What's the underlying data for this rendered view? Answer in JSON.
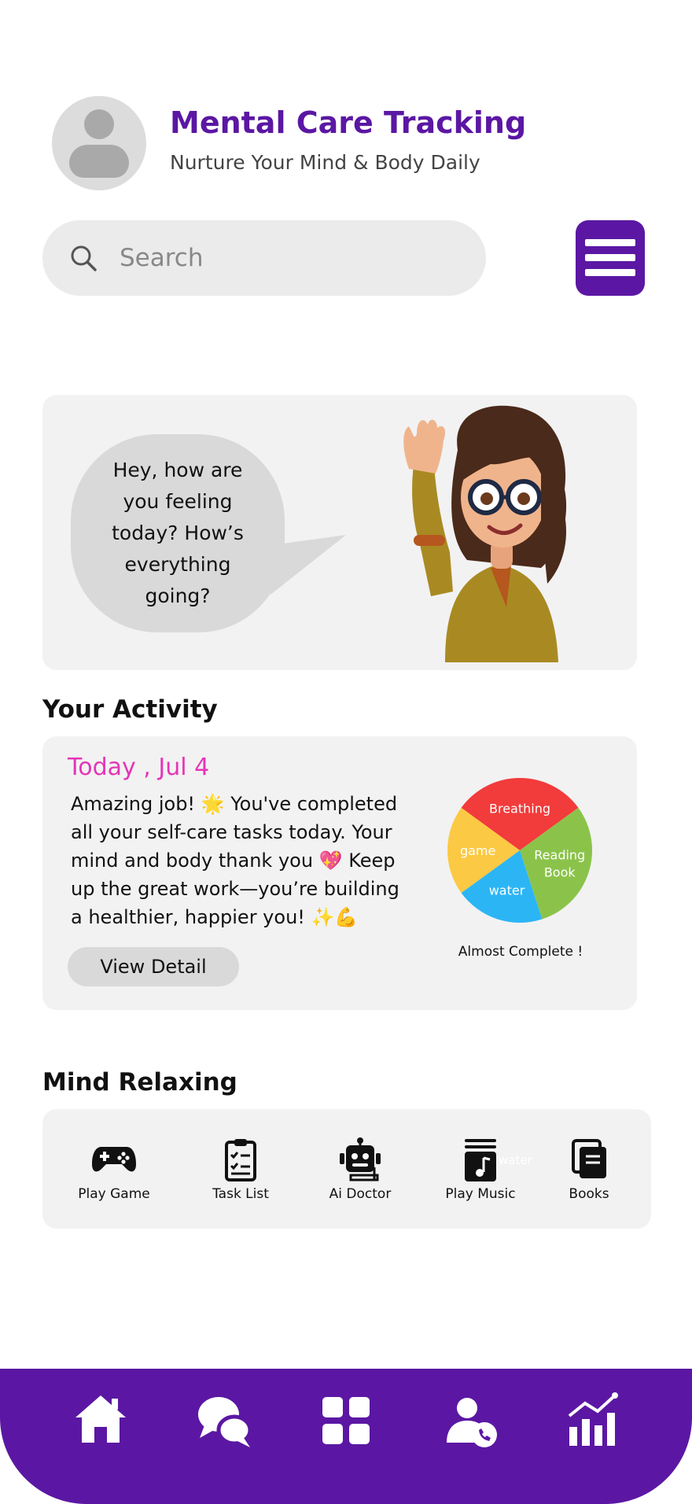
{
  "header": {
    "title": "Mental Care Tracking",
    "subtitle": "Nurture Your Mind & Body Daily"
  },
  "search": {
    "placeholder": "Search"
  },
  "hero": {
    "greeting": "Hey, how are you feeling today? How’s everything going?"
  },
  "activity": {
    "section_title": "Your Activity",
    "date": "Today , Jul 4",
    "message": "Amazing job! 🌟 You've completed all your self-care tasks today. Your mind and body thank you 💖 Keep up the great work—you’re building a healthier, happier you! ✨💪",
    "view_button": "View Detail",
    "caption": "Almost Complete !"
  },
  "chart_data": {
    "type": "pie",
    "title": "",
    "slices": [
      {
        "label": "Breathing",
        "value": 30,
        "color": "#f23b3b"
      },
      {
        "label": "Reading Book",
        "value": 30,
        "color": "#8bc34a"
      },
      {
        "label": "water",
        "value": 20,
        "color": "#2cb5f5"
      },
      {
        "label": "game",
        "value": 20,
        "color": "#fbc943"
      }
    ]
  },
  "relaxing": {
    "section_title": "Mind Relaxing",
    "items": [
      {
        "label": "Play Game",
        "icon": "gamepad-icon"
      },
      {
        "label": "Task List",
        "icon": "clipboard-icon"
      },
      {
        "label": "Ai Doctor",
        "icon": "robot-icon"
      },
      {
        "label": "Play Music",
        "icon": "music-icon"
      },
      {
        "label": "Books",
        "icon": "books-icon"
      }
    ],
    "ghost_text": "water"
  },
  "nav": {
    "items": [
      "home-icon",
      "chat-icon",
      "grid-icon",
      "user-call-icon",
      "stats-icon"
    ]
  },
  "colors": {
    "brand": "#5b17a3",
    "accent_pink": "#e535b8",
    "card_bg": "#f2f2f2"
  }
}
